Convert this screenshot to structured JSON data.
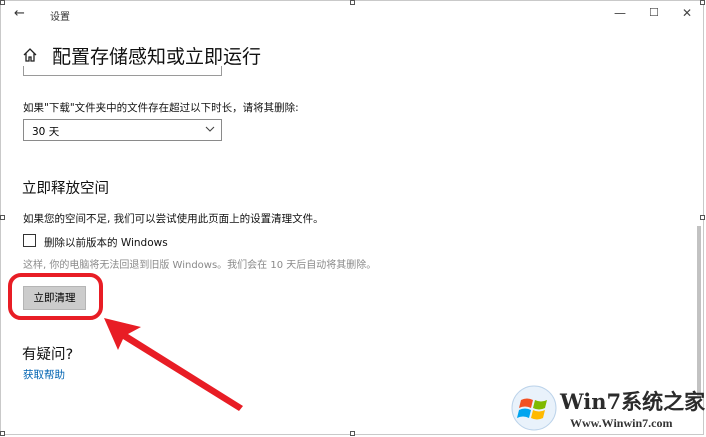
{
  "window": {
    "title": "设置",
    "back_glyph": "←",
    "minimize_glyph": "—",
    "maximize_glyph": "☐",
    "close_glyph": "✕"
  },
  "page": {
    "title": "配置存储感知或立即运行",
    "download_label": "如果\"下载\"文件夹中的文件存在超过以下时长，请将其删除:",
    "download_select_value": "30 天",
    "free_space_title": "立即释放空间",
    "free_space_desc": "如果您的空间不足, 我们可以尝试使用此页面上的设置清理文件。",
    "checkbox_label": "删除以前版本的 Windows",
    "checkbox_checked": false,
    "hint_text": "这样, 你的电脑将无法回退到旧版 Windows。我们会在 10 天后自动将其删除。",
    "clean_button": "立即清理",
    "questions_title": "有疑问?",
    "help_link": "获取帮助"
  },
  "annotation": {
    "color": "#e81d25"
  },
  "watermark": {
    "title": "Win7系统之家",
    "url": "Www.Winwin7.com"
  },
  "colors": {
    "link": "#0063b1",
    "button_bg": "#cccccc",
    "hint": "#8a8a8a"
  }
}
